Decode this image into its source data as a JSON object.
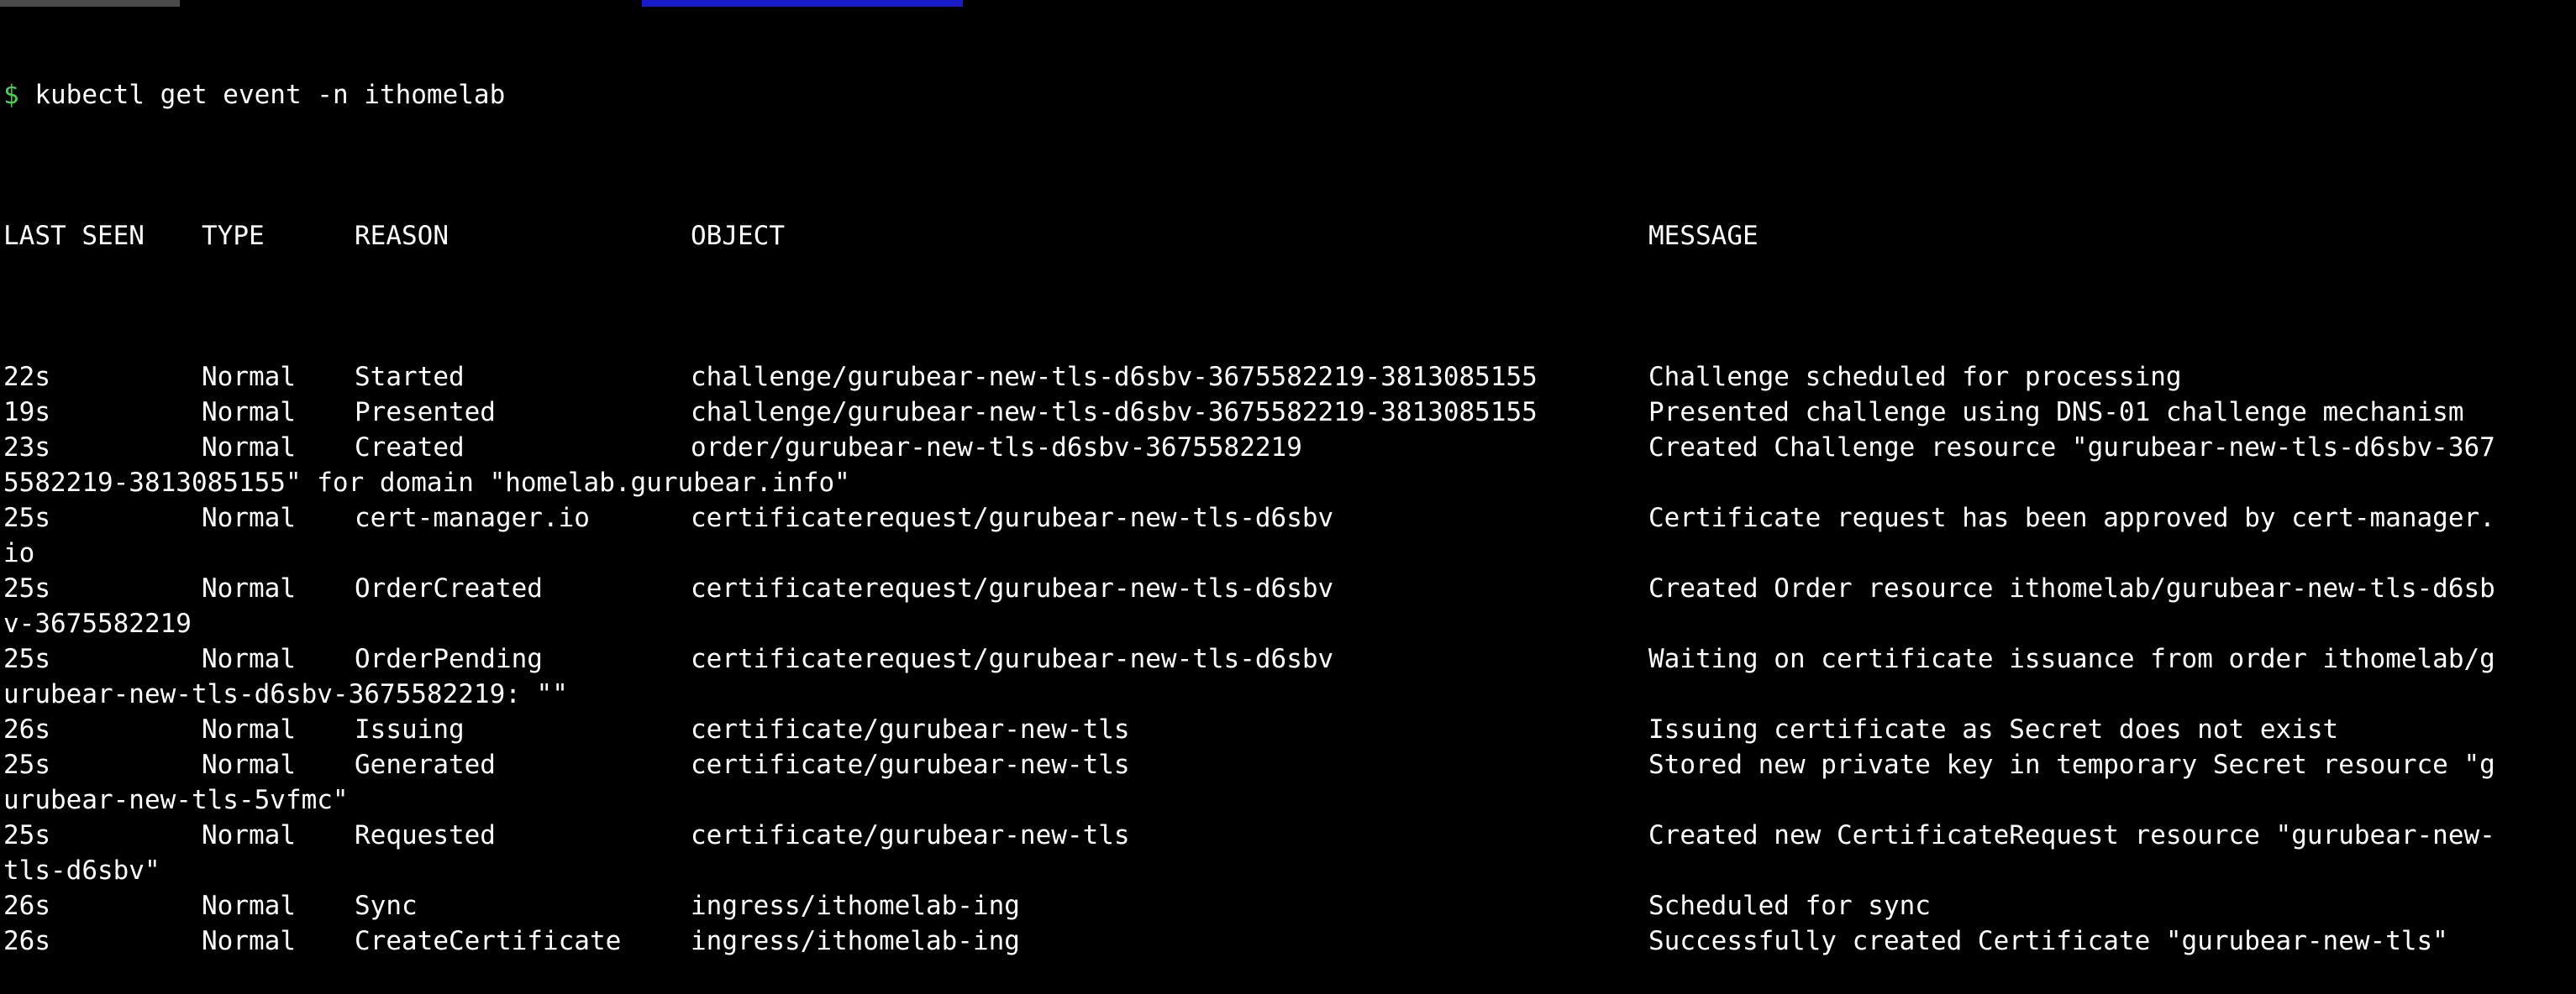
{
  "terminal": {
    "prompt_symbol": "$",
    "command": "kubectl get event -n ithomelab",
    "headers": {
      "last_seen": "LAST SEEN",
      "type": "TYPE",
      "reason": "REASON",
      "object": "OBJECT",
      "message": "MESSAGE"
    },
    "events": [
      {
        "last_seen": "22s",
        "type": "Normal",
        "reason": "Started",
        "object": "challenge/gurubear-new-tls-d6sbv-3675582219-3813085155",
        "message": "Challenge scheduled for processing",
        "wrap": ""
      },
      {
        "last_seen": "19s",
        "type": "Normal",
        "reason": "Presented",
        "object": "challenge/gurubear-new-tls-d6sbv-3675582219-3813085155",
        "message": "Presented challenge using DNS-01 challenge mechanism",
        "wrap": ""
      },
      {
        "last_seen": "23s",
        "type": "Normal",
        "reason": "Created",
        "object": "order/gurubear-new-tls-d6sbv-3675582219",
        "message": "Created Challenge resource \"gurubear-new-tls-d6sbv-367",
        "wrap": "5582219-3813085155\" for domain \"homelab.gurubear.info\""
      },
      {
        "last_seen": "25s",
        "type": "Normal",
        "reason": "cert-manager.io",
        "object": "certificaterequest/gurubear-new-tls-d6sbv",
        "message": "Certificate request has been approved by cert-manager.",
        "wrap": "io"
      },
      {
        "last_seen": "25s",
        "type": "Normal",
        "reason": "OrderCreated",
        "object": "certificaterequest/gurubear-new-tls-d6sbv",
        "message": "Created Order resource ithomelab/gurubear-new-tls-d6sb",
        "wrap": "v-3675582219"
      },
      {
        "last_seen": "25s",
        "type": "Normal",
        "reason": "OrderPending",
        "object": "certificaterequest/gurubear-new-tls-d6sbv",
        "message": "Waiting on certificate issuance from order ithomelab/g",
        "wrap": "urubear-new-tls-d6sbv-3675582219: \"\""
      },
      {
        "last_seen": "26s",
        "type": "Normal",
        "reason": "Issuing",
        "object": "certificate/gurubear-new-tls",
        "message": "Issuing certificate as Secret does not exist",
        "wrap": ""
      },
      {
        "last_seen": "25s",
        "type": "Normal",
        "reason": "Generated",
        "object": "certificate/gurubear-new-tls",
        "message": "Stored new private key in temporary Secret resource \"g",
        "wrap": "urubear-new-tls-5vfmc\""
      },
      {
        "last_seen": "25s",
        "type": "Normal",
        "reason": "Requested",
        "object": "certificate/gurubear-new-tls",
        "message": "Created new CertificateRequest resource \"gurubear-new-",
        "wrap": "tls-d6sbv\""
      },
      {
        "last_seen": "26s",
        "type": "Normal",
        "reason": "Sync",
        "object": "ingress/ithomelab-ing",
        "message": "Scheduled for sync",
        "wrap": ""
      },
      {
        "last_seen": "26s",
        "type": "Normal",
        "reason": "CreateCertificate",
        "object": "ingress/ithomelab-ing",
        "message": "Successfully created Certificate \"gurubear-new-tls\"",
        "wrap": ""
      }
    ]
  },
  "colors": {
    "background": "#000000",
    "text": "#ffffff",
    "prompt": "#3fd74a",
    "selection": "#1a1ac8"
  }
}
